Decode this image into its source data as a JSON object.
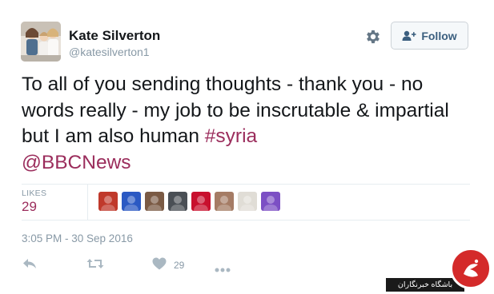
{
  "colors": {
    "text": "#14171a",
    "muted": "#8899a6",
    "link": "#9b2d5c",
    "follow_text": "#3b5f7f",
    "border": "#e6ecf0"
  },
  "author": {
    "name": "Kate Silverton",
    "handle": "@katesilverton1"
  },
  "buttons": {
    "follow_label": "Follow",
    "settings_icon": "gear-icon"
  },
  "tweet": {
    "text_plain": "To all of you sending thoughts - thank you - no words really - my job to be inscrutable & impartial but I am also human",
    "hashtag": "#syria",
    "mention": "@BBCNews",
    "timestamp": "3:05 PM - 30 Sep 2016"
  },
  "stats": {
    "likes_label": "LIKES",
    "likes_count": "29"
  },
  "likers": [
    {
      "icon": "avatar-red-group",
      "color": "#c0392b"
    },
    {
      "icon": "avatar-blue-group",
      "color": "#2b59c3"
    },
    {
      "icon": "avatar-face",
      "color": "#7a5a44"
    },
    {
      "icon": "avatar-dark-scene",
      "color": "#4a4f55"
    },
    {
      "icon": "avatar-union-jack-tongue",
      "color": "#c8102e"
    },
    {
      "icon": "avatar-woman",
      "color": "#a57c65"
    },
    {
      "icon": "avatar-love-sign",
      "color": "#e0ddd6"
    },
    {
      "icon": "avatar-purple-logo",
      "color": "#7c4fc4"
    }
  ],
  "actions": {
    "reply_icon": "reply-icon",
    "retweet_icon": "retweet-icon",
    "like_icon": "heart-icon",
    "like_count": "29",
    "more_icon": "more-dots-icon"
  },
  "watermark": {
    "text": "باشگاه خبرنگاران"
  }
}
